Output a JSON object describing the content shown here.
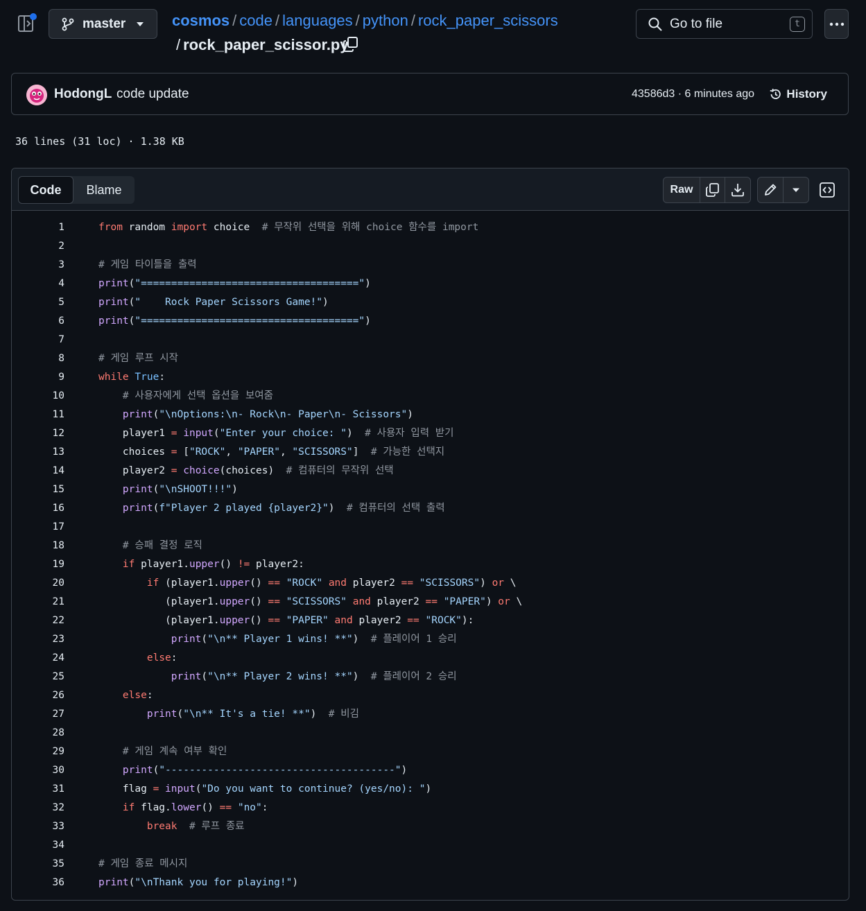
{
  "header": {
    "branch": "master",
    "breadcrumb": [
      "cosmos",
      "code",
      "languages",
      "python",
      "rock_paper_scissors"
    ],
    "separator": "/",
    "filename": "rock_paper_scissor.py",
    "go_to_file": "Go to file",
    "shortcut_key": "t"
  },
  "commit": {
    "author": "HodongL",
    "message": "code update",
    "hash_time": "43586d3 · 6 minutes ago",
    "history": "History"
  },
  "file_meta": "36 lines (31 loc) · 1.38 KB",
  "toolbar": {
    "code_tab": "Code",
    "blame_tab": "Blame",
    "raw": "Raw"
  },
  "code": [
    "from random import choice  # 무작위 선택을 위해 choice 함수를 import",
    "",
    "# 게임 타이틀을 출력",
    "print(\"====================================\")",
    "print(\"    Rock Paper Scissors Game!\")",
    "print(\"====================================\")",
    "",
    "# 게임 루프 시작",
    "while True:",
    "    # 사용자에게 선택 옵션을 보여줌",
    "    print(\"\\nOptions:\\n- Rock\\n- Paper\\n- Scissors\")",
    "    player1 = input(\"Enter your choice: \")  # 사용자 입력 받기",
    "    choices = [\"ROCK\", \"PAPER\", \"SCISSORS\"]  # 가능한 선택지",
    "    player2 = choice(choices)  # 컴퓨터의 무작위 선택",
    "    print(\"\\nSHOOT!!!\")",
    "    print(f\"Player 2 played {player2}\")  # 컴퓨터의 선택 출력",
    "",
    "    # 승패 결정 로직",
    "    if player1.upper() != player2:",
    "        if (player1.upper() == \"ROCK\" and player2 == \"SCISSORS\") or \\",
    "           (player1.upper() == \"SCISSORS\" and player2 == \"PAPER\") or \\",
    "           (player1.upper() == \"PAPER\" and player2 == \"ROCK\"):",
    "            print(\"\\n** Player 1 wins! **\")  # 플레이어 1 승리",
    "        else:",
    "            print(\"\\n** Player 2 wins! **\")  # 플레이어 2 승리",
    "    else:",
    "        print(\"\\n** It's a tie! **\")  # 비김",
    "",
    "    # 게임 계속 여부 확인",
    "    print(\"--------------------------------------\")",
    "    flag = input(\"Do you want to continue? (yes/no): \")",
    "    if flag.lower() == \"no\":",
    "        break  # 루프 종료",
    "",
    "# 게임 종료 메시지",
    "print(\"\\nThank you for playing!\")"
  ]
}
